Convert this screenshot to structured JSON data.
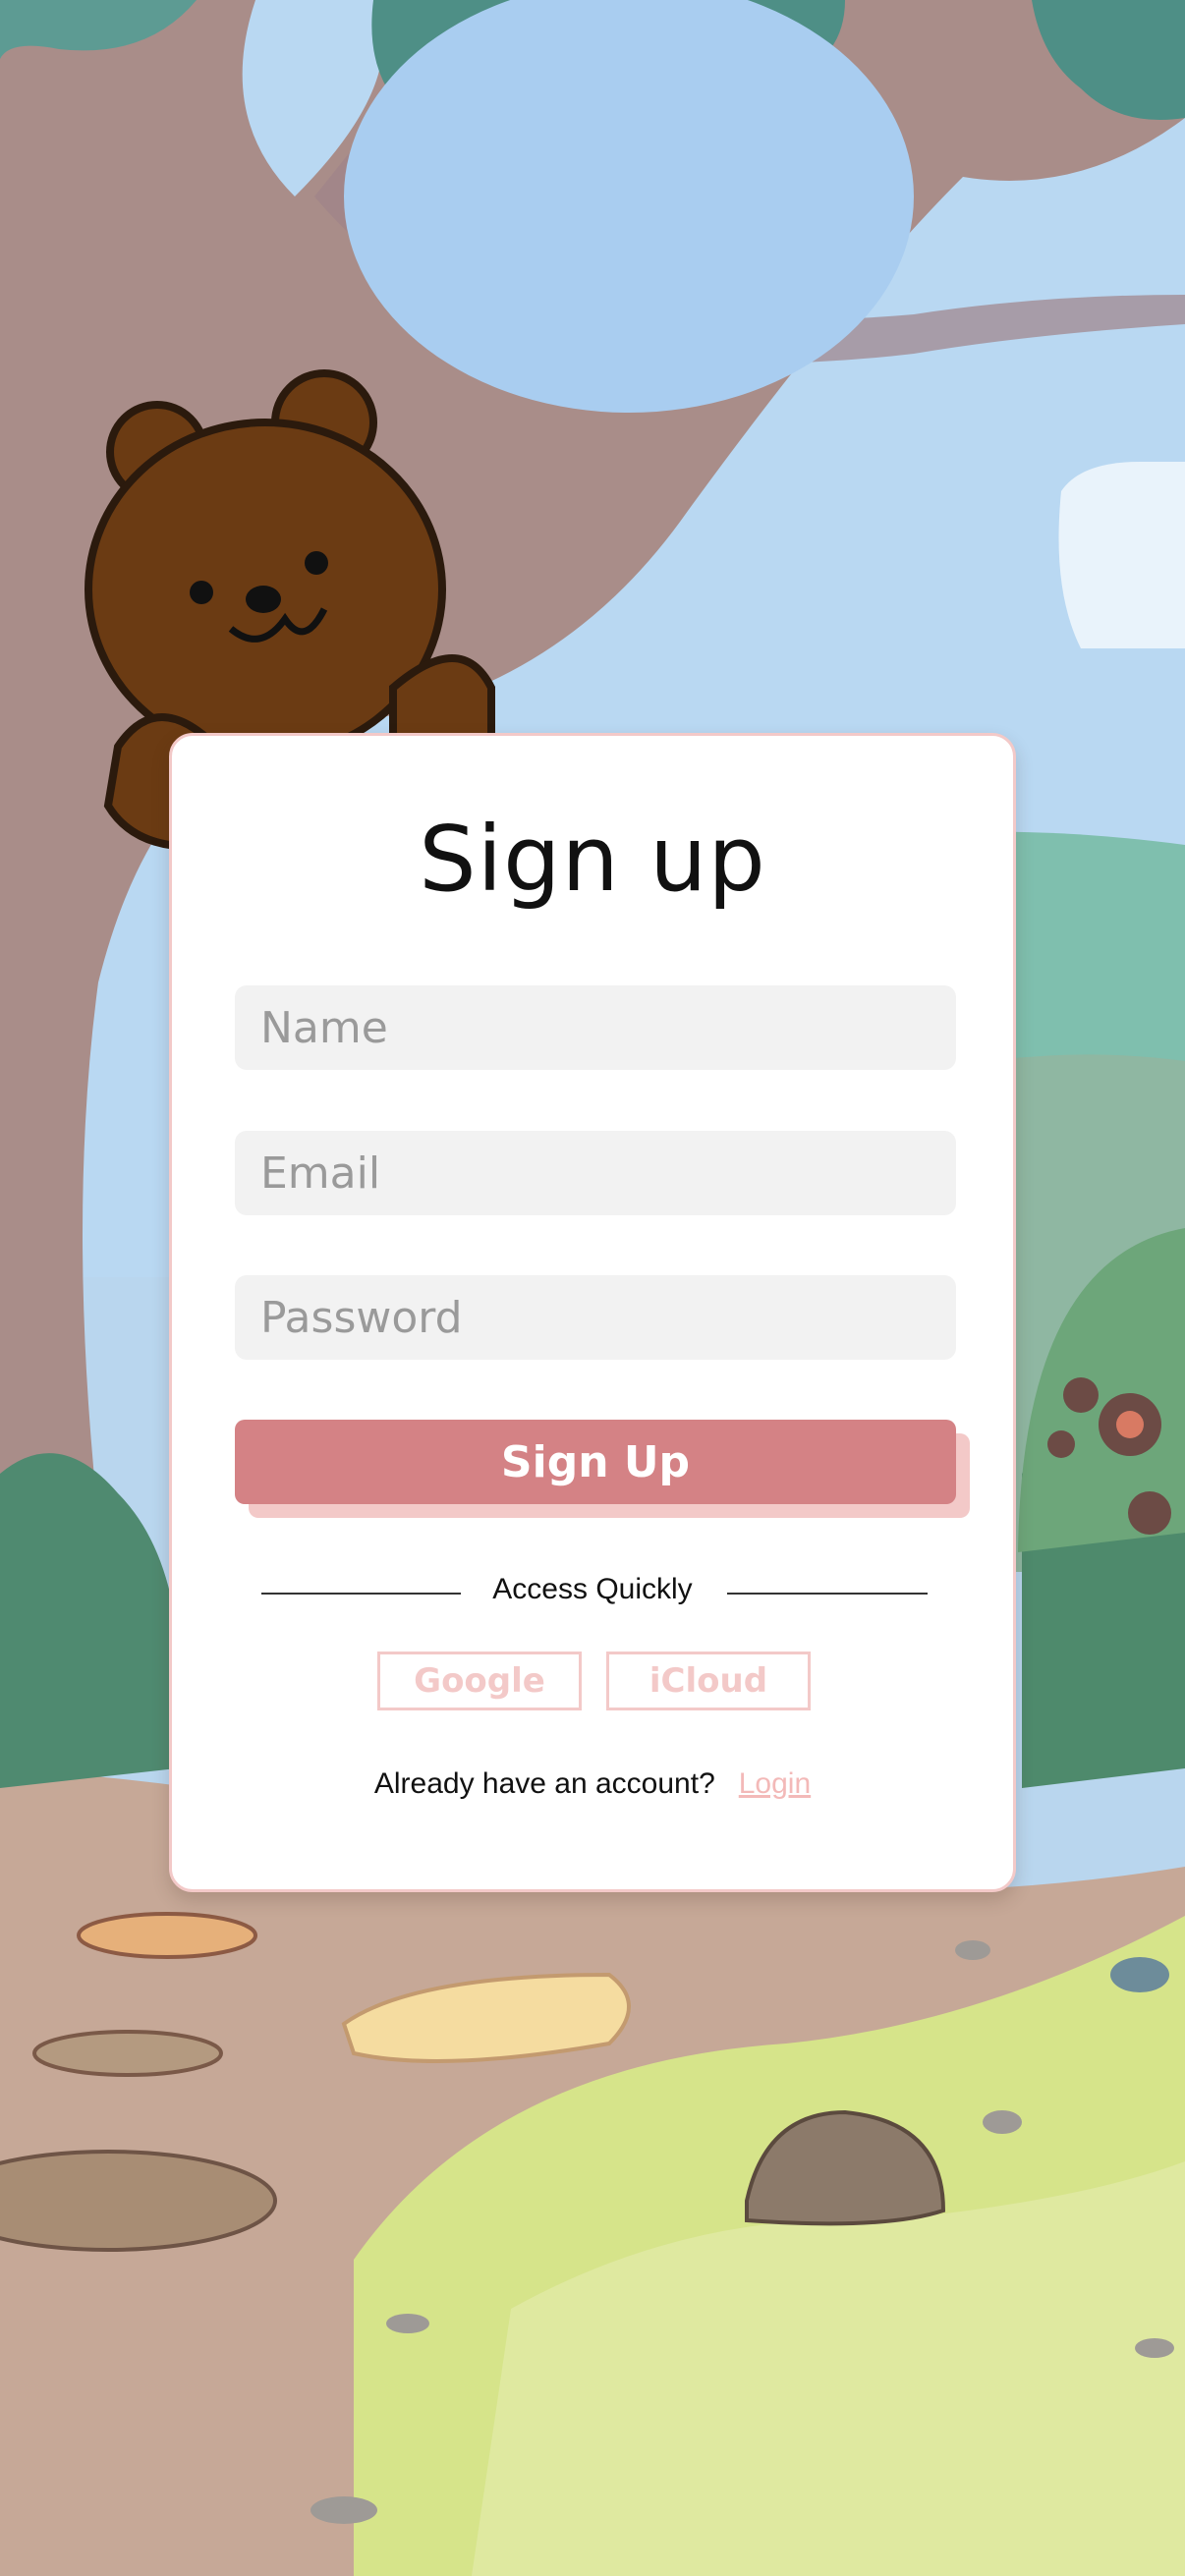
{
  "form": {
    "title": "Sign up",
    "name_placeholder": "Name",
    "email_placeholder": "Email",
    "password_placeholder": "Password",
    "submit_label": "Sign Up",
    "divider_text": "Access Quickly",
    "quick_options": [
      "Google",
      "iCloud"
    ],
    "account_prompt": "Already have an account?",
    "login_label": "Login"
  },
  "colors": {
    "accent": "#d48285",
    "accent_light": "#f3c9c8",
    "field_bg": "#f2f2f2"
  },
  "icons": {
    "mascot": "bear-mascot"
  }
}
